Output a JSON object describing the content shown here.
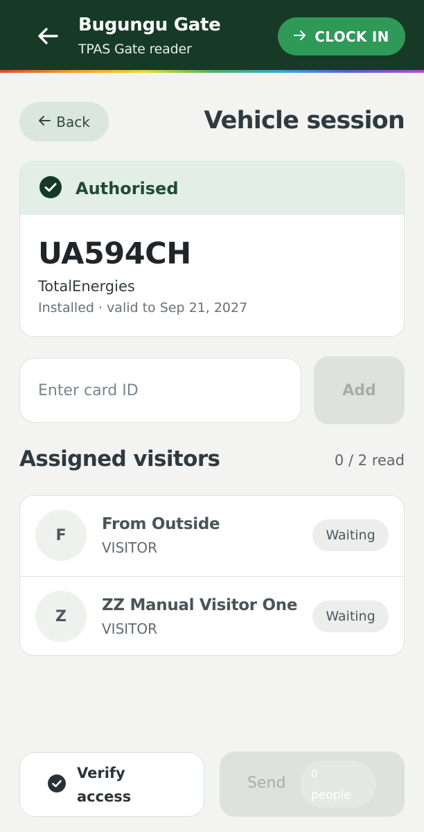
{
  "header": {
    "title": "Bugungu Gate",
    "subtitle": "TPAS Gate reader",
    "clock_in_label": "CLOCK IN",
    "back_icon": "arrow-left-icon",
    "clock_in_icon": "arrow-right-icon"
  },
  "page": {
    "back_label": "Back",
    "title": "Vehicle session"
  },
  "vehicle": {
    "status": "Authorised",
    "status_icon": "check-circle-icon",
    "plate": "UA594CH",
    "company": "TotalEnergies",
    "validity": "Installed · valid to Sep 21, 2027"
  },
  "card_entry": {
    "placeholder": "Enter card ID",
    "value": "",
    "add_label": "Add"
  },
  "visitors": {
    "title": "Assigned visitors",
    "read_count": "0 / 2 read",
    "items": [
      {
        "initial": "F",
        "name": "From Outside",
        "role": "VISITOR",
        "status": "Waiting"
      },
      {
        "initial": "Z",
        "name": "ZZ Manual Visitor One",
        "role": "VISITOR",
        "status": "Waiting"
      }
    ]
  },
  "footer": {
    "verify_line1": "Verify",
    "verify_line2": "access",
    "send_label": "Send",
    "people_count": "0",
    "people_label": "people"
  },
  "colors": {
    "header_bg": "#173a27",
    "accent_green": "#2f9958",
    "authorised_bg": "#e3efe6",
    "page_bg": "#f3f4f2"
  }
}
